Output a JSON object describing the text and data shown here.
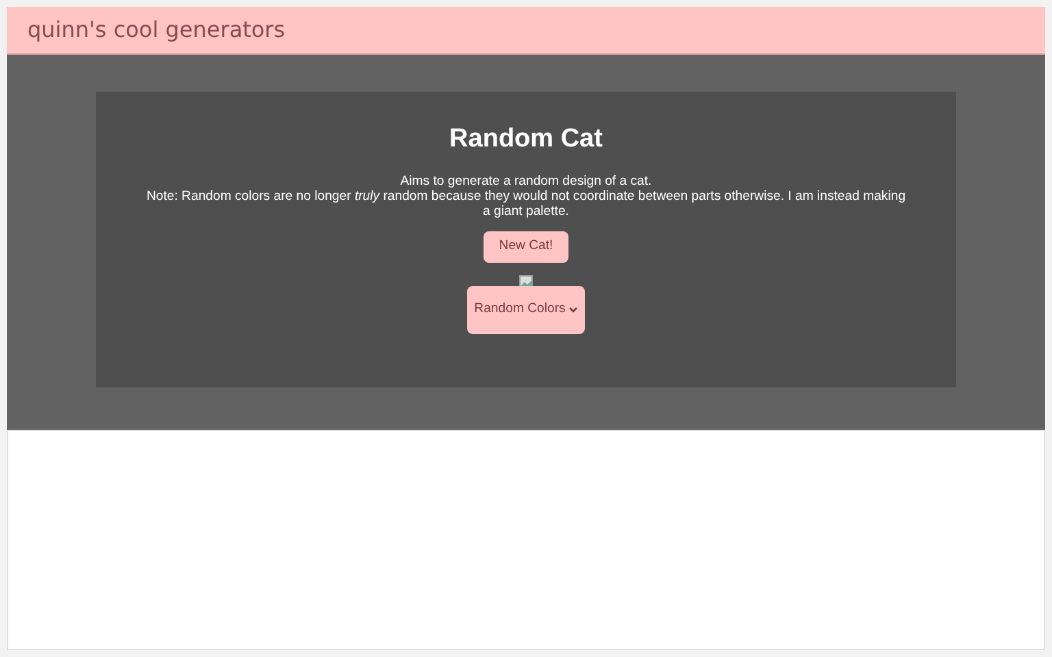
{
  "header": {
    "title": "quinn's cool generators"
  },
  "card": {
    "title": "Random Cat",
    "description": [
      "Aims to generate a random design of a cat.",
      "Note: Random colors are no longer *truly* random because they would not coordinate between parts otherwise. I am instead making a giant palette."
    ],
    "button": "New Cat!",
    "select": {
      "value": "Random Colors"
    }
  }
}
